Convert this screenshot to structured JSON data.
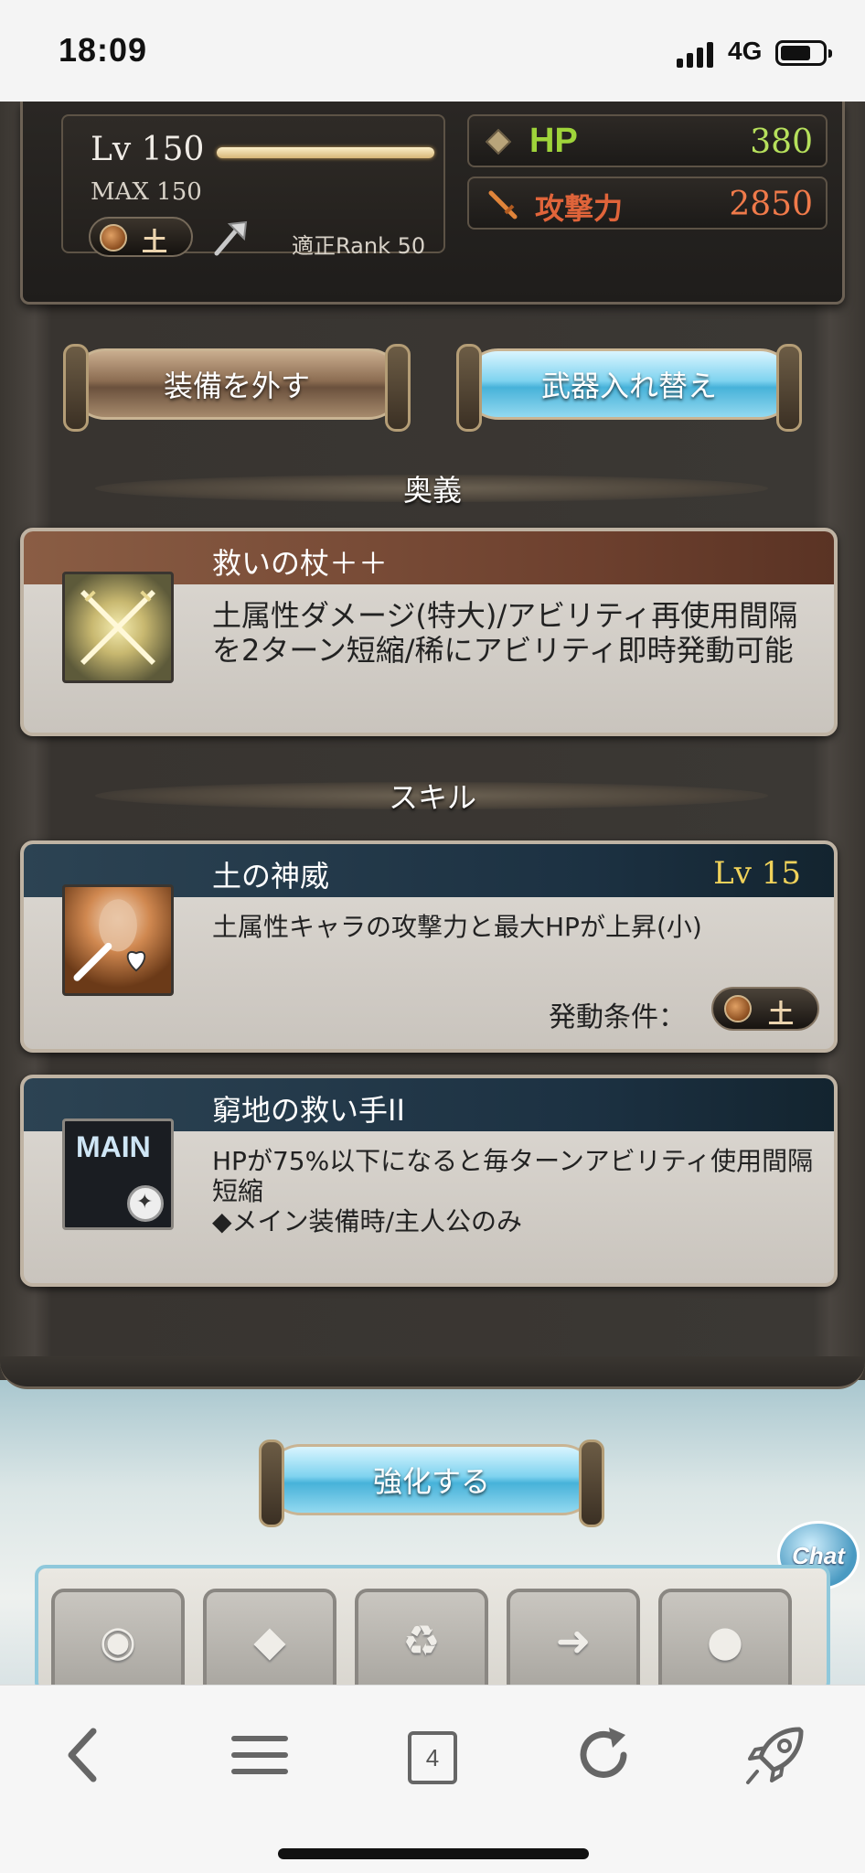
{
  "status_bar": {
    "time": "18:09",
    "network": "4G"
  },
  "character": {
    "level_label": "Lv 150",
    "max_label": "MAX 150",
    "element": "土",
    "rank_label": "適正Rank 50"
  },
  "stats": {
    "hp_label": "HP",
    "hp_value": "380",
    "atk_label": "攻撃力",
    "atk_value": "2850"
  },
  "buttons": {
    "unequip": "装備を外す",
    "swap_weapon": "武器入れ替え",
    "enhance": "強化する"
  },
  "sections": {
    "ougi": "奥義",
    "skill": "スキル"
  },
  "ougi": {
    "name": "救いの杖＋＋",
    "description": "土属性ダメージ(特大)/アビリティ再使用間隔を2ターン短縮/稀にアビリティ即時発動可能"
  },
  "skills": [
    {
      "name": "土の神威",
      "level": "Lv 15",
      "description": "土属性キャラの攻撃力と最大HPが上昇(小)",
      "condition_label": "発動条件：",
      "condition_element": "土"
    },
    {
      "name": "窮地の救い手II",
      "icon_text": "MAIN",
      "description_line1": "HPが75%以下になると毎ターンアビリティ使用間隔短縮",
      "description_line2": "◆メイン装備時/主人公のみ"
    }
  ],
  "chat": "Chat",
  "browser": {
    "tab_count": "4"
  },
  "icons": {
    "back": "chevron-left-icon",
    "menu": "hamburger-menu-icon",
    "tabs": "tab-count-icon",
    "reload": "reload-icon",
    "rocket": "rocket-icon"
  }
}
